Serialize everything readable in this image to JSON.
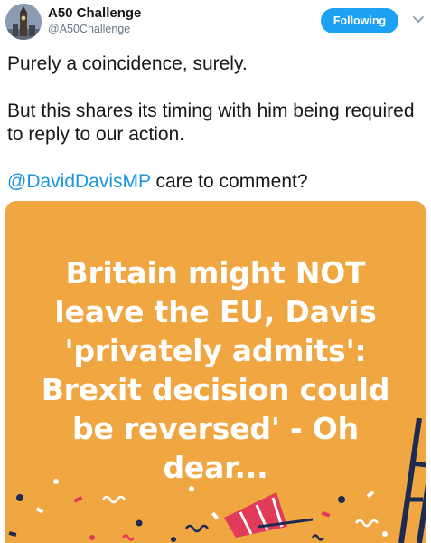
{
  "header": {
    "display_name": "A50 Challenge",
    "handle": "@A50Challenge",
    "follow_label": "Following"
  },
  "tweet": {
    "line1": "Purely a coincidence, surely.",
    "line2": "But this shares its timing with him being required to reply to our action.",
    "mention": "@DavidDavisMP",
    "line3_rest": " care to comment?"
  },
  "media": {
    "headline_lines": [
      "Britain might NOT",
      "leave the EU, Davis",
      "'privately admits':",
      "Brexit decision could",
      "be reversed' - Oh",
      "dear..."
    ],
    "background_color": "#f0a742"
  },
  "colors": {
    "accent": "#1da1f2",
    "link": "#1b95e0",
    "text": "#14171a",
    "secondary": "#657786"
  }
}
